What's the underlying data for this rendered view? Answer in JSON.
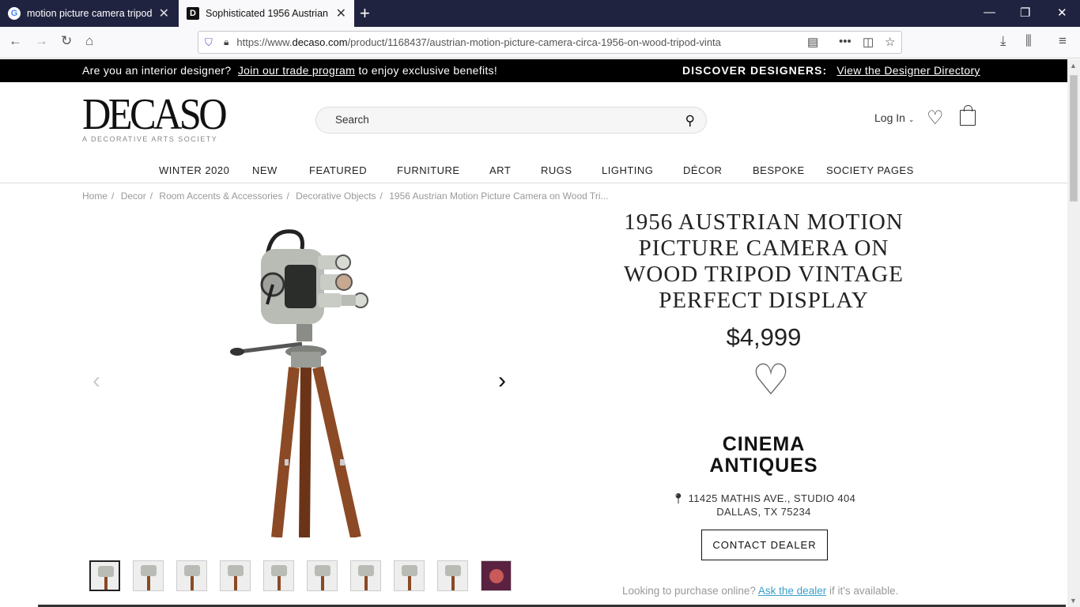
{
  "browser": {
    "tabs": [
      {
        "title": "motion picture camera tripod -",
        "favicon": "G"
      },
      {
        "title": "Sophisticated 1956 Austrian Mo",
        "favicon": "D"
      }
    ],
    "url_prefix": "https://www.",
    "url_domain": "decaso.com",
    "url_path": "/product/1168437/austrian-motion-picture-camera-circa-1956-on-wood-tripod-vinta"
  },
  "promo": {
    "question": "Are you an interior designer?",
    "link": "Join our trade program",
    "suffix": "to enjoy exclusive benefits!",
    "discover_label": "DISCOVER DESIGNERS:",
    "discover_link": "View the Designer Directory"
  },
  "header": {
    "logo_main": "DECASO",
    "logo_tagline": "A DECORATIVE ARTS SOCIETY",
    "search_placeholder": "Search",
    "login": "Log In"
  },
  "nav": [
    "WINTER 2020",
    "NEW",
    "FEATURED",
    "FURNITURE",
    "ART",
    "RUGS",
    "LIGHTING",
    "DÉCOR",
    "BESPOKE",
    "SOCIETY PAGES"
  ],
  "breadcrumb": [
    "Home",
    "Decor",
    "Room Accents & Accessories",
    "Decorative Objects",
    "1956 Austrian Motion Picture Camera on Wood Tri..."
  ],
  "product": {
    "title": "1956 AUSTRIAN MOTION PICTURE CAMERA ON WOOD TRIPOD VINTAGE PERFECT DISPLAY",
    "price": "$4,999",
    "dealer_line1": "CINEMA",
    "dealer_line2": "ANTIQUES",
    "address_line1": "11425 MATHIS AVE., STUDIO 404",
    "address_line2": "DALLAS, TX 75234",
    "contact_button": "CONTACT DEALER",
    "purchase_prefix": "Looking to purchase online?",
    "purchase_link": "Ask the dealer",
    "purchase_suffix": "if it's available."
  },
  "colors": {
    "tabbar": "#202340",
    "promo_bg": "#000000",
    "link_blue": "#3aa0c8",
    "tripod_wood": "#8b4a25",
    "camera_body": "#b9bcb5"
  }
}
